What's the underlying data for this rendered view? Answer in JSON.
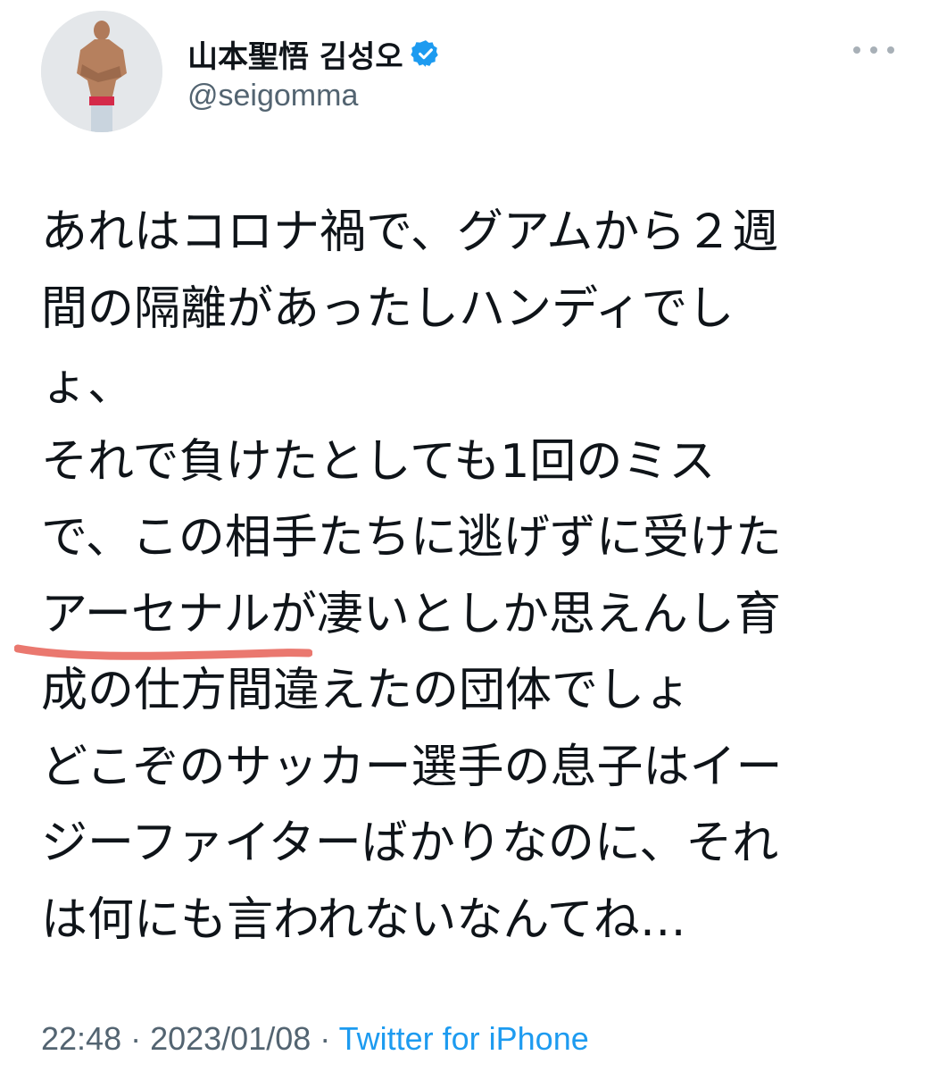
{
  "author": {
    "display_name": "山本聖悟 김성오",
    "handle": "@seigomma",
    "verified_icon": "verified-badge-icon"
  },
  "tweet": {
    "lines": [
      "あれはコロナ禍で、グアムから２週",
      "間の隔離があったしハンディでし",
      "ょ、",
      "それで負けたとしても1回のミス",
      "で、この相手たちに逃げずに受けた",
      "アーセナルが凄いとしか思えんし育",
      "成の仕方間違えたの団体でしょ",
      "どこぞのサッカー選手の息子はイー",
      "ジーファイターばかりなのに、それ",
      "は何にも言われないなんてね…"
    ]
  },
  "meta": {
    "time": "22:48",
    "separator": " · ",
    "date": "2023/01/08",
    "source": "Twitter for iPhone"
  },
  "colors": {
    "text": "#0f1419",
    "secondary": "#536471",
    "link": "#1d9bf0",
    "highlight": "#e8695f"
  }
}
